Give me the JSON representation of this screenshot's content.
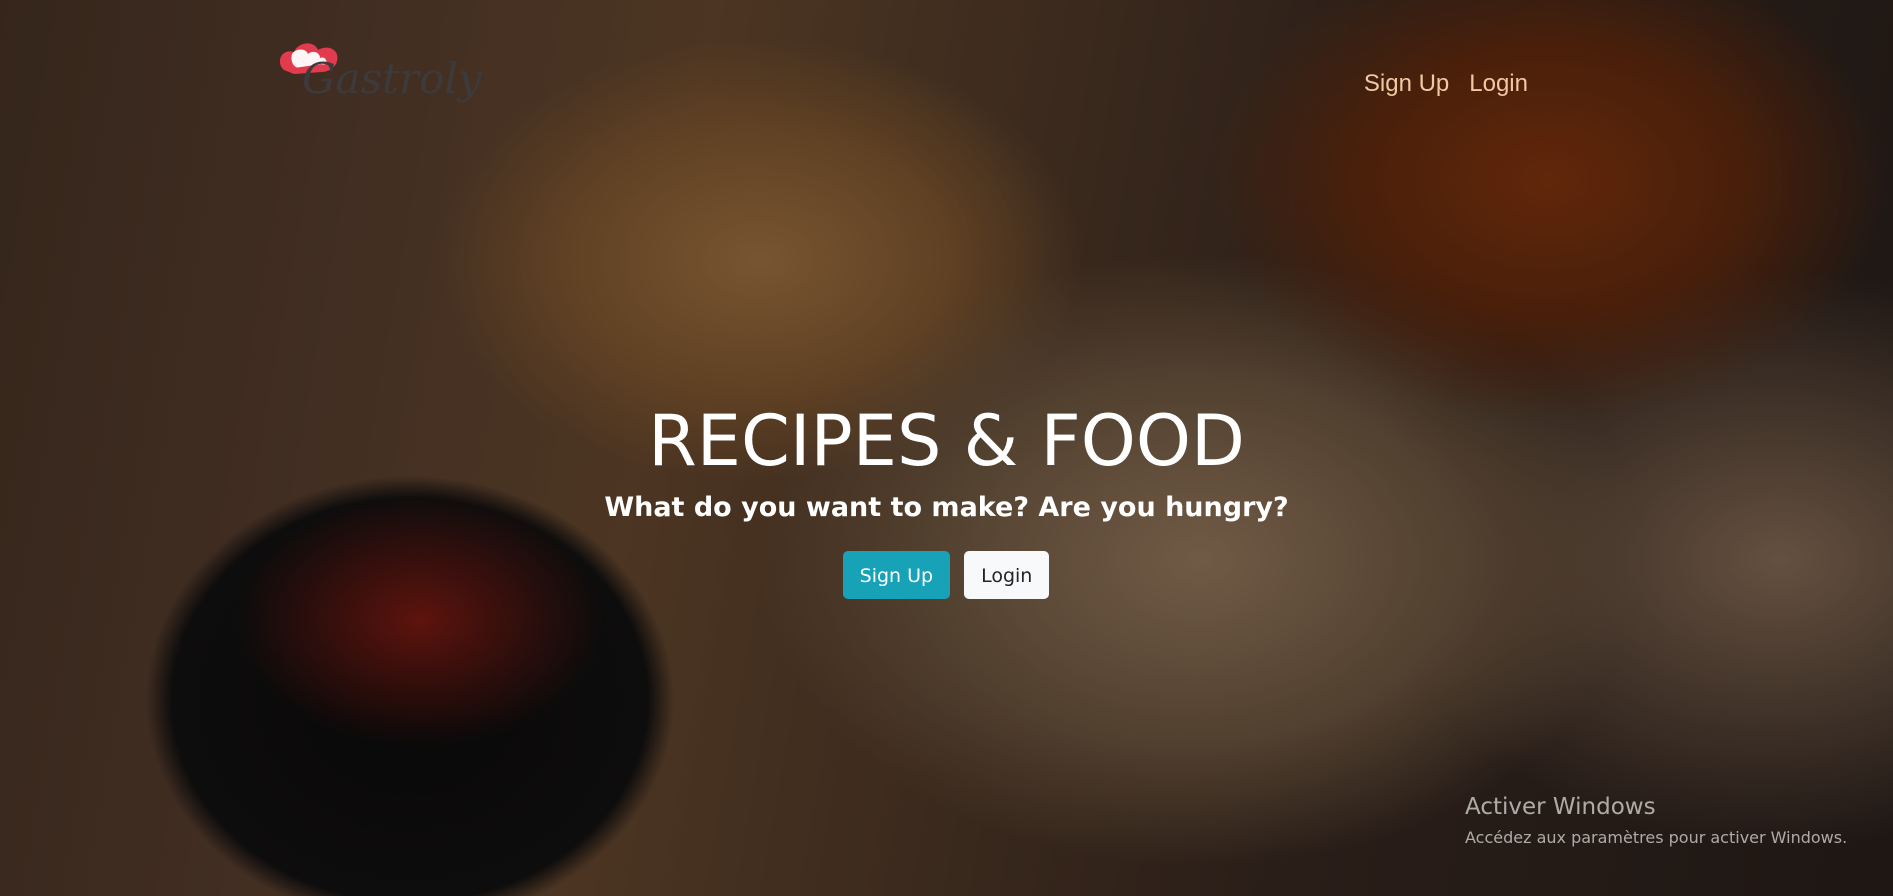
{
  "brand": {
    "name": "Gastroly",
    "hat_color": "#e23b4d"
  },
  "nav": {
    "signup_label": "Sign Up",
    "login_label": "Login",
    "link_color": "#f0c9a2"
  },
  "hero": {
    "title": "RECIPES & FOOD",
    "subtitle": "What do you want to make? Are you hungry?",
    "signup_button": "Sign Up",
    "login_button": "Login",
    "primary_color": "#17a2b8"
  },
  "watermark": {
    "title": "Activer Windows",
    "subtitle": "Accédez aux paramètres pour activer Windows."
  }
}
